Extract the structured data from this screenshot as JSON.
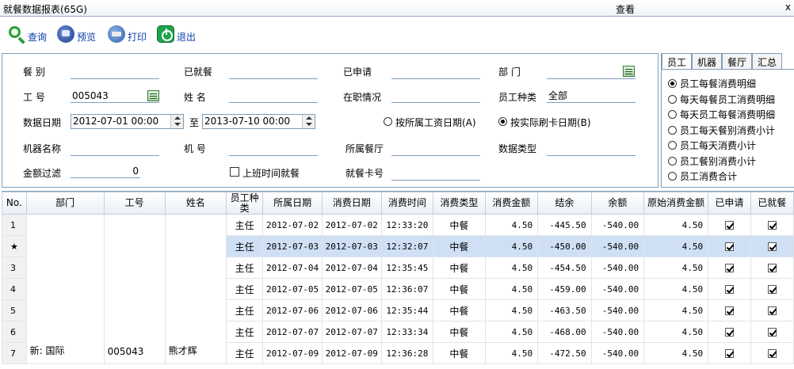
{
  "titlebar": {
    "title": "就餐数据报表(65G)",
    "view": "查看",
    "close": "x"
  },
  "toolbar": {
    "query": "查询",
    "preview": "预览",
    "print": "打印",
    "exit": "退出"
  },
  "filters": {
    "meal_type_label": "餐    别",
    "ate_label": "已就餐",
    "applied_label": "已申请",
    "dept_label": "部    门",
    "emp_no_label": "工    号",
    "emp_no_value": "005043",
    "name_label": "姓    名",
    "in_service_label": "在职情况",
    "emp_type_label": "员工种类",
    "emp_type_value": "全部",
    "date_label": "数据日期",
    "date_from": "2012-07-01 00:00",
    "date_to_sep": "至",
    "date_to": "2013-07-10 00:00",
    "radio_payroll": "按所属工资日期(A)",
    "radio_actual": "按实际刷卡日期(B)",
    "machine_name_label": "机器名称",
    "machine_no_label": "机    号",
    "canteen_label": "所属餐厅",
    "data_type_label": "数据类型",
    "amount_filter_label": "金额过滤",
    "amount_filter_value": "0",
    "work_time_label": "上班时间就餐",
    "card_no_label": "就餐卡号"
  },
  "right_panel": {
    "tabs": [
      "员工",
      "机器",
      "餐厅",
      "汇总"
    ],
    "options": [
      {
        "label": "员工每餐消费明细",
        "selected": true
      },
      {
        "label": "每天每餐员工消费明细",
        "selected": false
      },
      {
        "label": "每天员工每餐消费明细",
        "selected": false
      },
      {
        "label": "员工每天餐别消费小计",
        "selected": false
      },
      {
        "label": "员工每天消费小计",
        "selected": false
      },
      {
        "label": "员工餐别消费小计",
        "selected": false
      },
      {
        "label": "员工消费合计",
        "selected": false
      }
    ]
  },
  "grid": {
    "headers": [
      "No.",
      "部门",
      "工号",
      "姓名",
      "员工种类",
      "所属日期",
      "消费日期",
      "消费时间",
      "消费类型",
      "消费金额",
      "结余",
      "余额",
      "原始消费金额",
      "已申请",
      "已就餐"
    ],
    "merged": {
      "dept": "新:  国际",
      "emp_no": "005043",
      "name": "熊才辉"
    },
    "rows": [
      {
        "no": "1",
        "type": "主任",
        "belong": "2012-07-02",
        "date": "2012-07-02",
        "time": "12:33:20",
        "meal": "中餐",
        "amount": "4.50",
        "balance": "-445.50",
        "remain": "-540.00",
        "orig": "4.50",
        "applied": true,
        "ate": true
      },
      {
        "no": "★",
        "type": "主任",
        "belong": "2012-07-03",
        "date": "2012-07-03",
        "time": "12:32:07",
        "meal": "中餐",
        "amount": "4.50",
        "balance": "-450.00",
        "remain": "-540.00",
        "orig": "4.50",
        "applied": true,
        "ate": true
      },
      {
        "no": "3",
        "type": "主任",
        "belong": "2012-07-04",
        "date": "2012-07-04",
        "time": "12:35:45",
        "meal": "中餐",
        "amount": "4.50",
        "balance": "-454.50",
        "remain": "-540.00",
        "orig": "4.50",
        "applied": true,
        "ate": true
      },
      {
        "no": "4",
        "type": "主任",
        "belong": "2012-07-05",
        "date": "2012-07-05",
        "time": "12:36:07",
        "meal": "中餐",
        "amount": "4.50",
        "balance": "-459.00",
        "remain": "-540.00",
        "orig": "4.50",
        "applied": true,
        "ate": true
      },
      {
        "no": "5",
        "type": "主任",
        "belong": "2012-07-06",
        "date": "2012-07-06",
        "time": "12:35:44",
        "meal": "中餐",
        "amount": "4.50",
        "balance": "-463.50",
        "remain": "-540.00",
        "orig": "4.50",
        "applied": true,
        "ate": true
      },
      {
        "no": "6",
        "type": "主任",
        "belong": "2012-07-07",
        "date": "2012-07-07",
        "time": "12:33:34",
        "meal": "中餐",
        "amount": "4.50",
        "balance": "-468.00",
        "remain": "-540.00",
        "orig": "4.50",
        "applied": true,
        "ate": true
      },
      {
        "no": "7",
        "type": "主任",
        "belong": "2012-07-09",
        "date": "2012-07-09",
        "time": "12:36:28",
        "meal": "中餐",
        "amount": "4.50",
        "balance": "-472.50",
        "remain": "-540.00",
        "orig": "4.50",
        "applied": true,
        "ate": true
      }
    ]
  },
  "colors": {
    "accent": "#0b3fa8",
    "selected_row": "#cfe0f5",
    "border": "#7f9db9"
  }
}
